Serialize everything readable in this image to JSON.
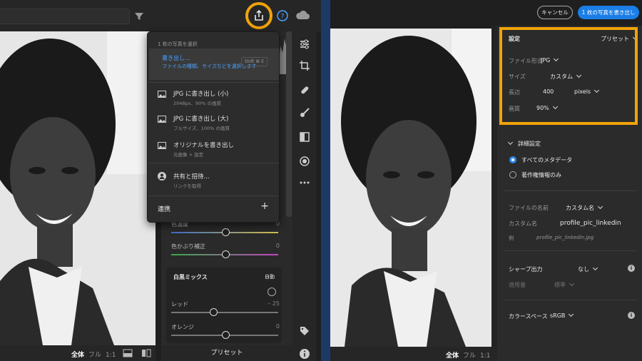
{
  "menu": {
    "header": "1 枚の写真を選択",
    "export_title": "書き出し...",
    "export_sub": "ファイルの種類、サイズなどを選択します",
    "export_shortcut": "Shift ⌘ E",
    "items": [
      {
        "title": "JPG に書き出し (小)",
        "sub": "2048px、90% の画質"
      },
      {
        "title": "JPG に書き出し (大)",
        "sub": "フルサイズ、100% の画質"
      },
      {
        "title": "オリジナルを書き出し",
        "sub": "元画像 + 設定"
      }
    ],
    "share_title": "共有と招待...",
    "share_sub": "リンクを取得",
    "renkei": "連携",
    "plus": "+"
  },
  "develop": {
    "temp_label": "色温度",
    "temp_value": "0",
    "tint_label": "色かぶり補正",
    "tint_value": "0",
    "bw_title": "白黒ミックス",
    "bw_auto": "自動",
    "red_label": "レッド",
    "red_value": "– 25",
    "orange_label": "オレンジ",
    "orange_value": "0"
  },
  "bottom_left": {
    "all": "全体",
    "fit": "フル",
    "ratio": "1:1"
  },
  "bottom_preset": "プリセット",
  "bottom_right": {
    "all": "全体",
    "fit": "フル",
    "ratio": "1:1"
  },
  "header_right": {
    "cancel": "キャンセル",
    "export": "1 枚の写真を書き出し"
  },
  "settings": {
    "title": "設定",
    "preset": "プリセット",
    "filetype_label": "ファイル形式",
    "filetype_value": "JPG",
    "size_label": "サイズ",
    "size_value": "カスタム",
    "long_edge_label": "長辺",
    "long_edge_value": "400",
    "unit_value": "pixels",
    "quality_label": "画質",
    "quality_value": "90%"
  },
  "advanced": {
    "title": "詳細設定",
    "meta_all": "すべてのメタデータ",
    "meta_copyright": "著作権情報のみ",
    "filename_label": "ファイルの名前",
    "filename_value": "カスタム名",
    "custom_label": "カスタム名",
    "custom_value": "profile_pic_linkedin",
    "example_label": "例",
    "example_value": "profile_pic_linkedin.jpg",
    "sharpen_label": "シャープ出力",
    "sharpen_value": "なし",
    "amount_label": "適用量",
    "amount_value": "標準",
    "colorspace_label": "カラースペース",
    "colorspace_value": "sRGB"
  },
  "colors": {
    "highlight": "#f0a30a",
    "accent": "#1a7ee6",
    "divider": "#1c3a66"
  }
}
